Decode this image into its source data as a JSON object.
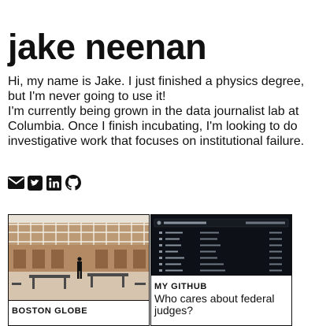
{
  "header": {
    "name": "jake neenan"
  },
  "bio": {
    "line1": "Hi, my name is Jake. I just finished a physics degree, but I'm never going to use it!",
    "line2": "I'm currently being grown in the data journalist lab at Columbia. Once I finish incubating, I'm looking to do investigative work that focuses on institutional failure."
  },
  "social": {
    "items": [
      {
        "icon": "email-icon"
      },
      {
        "icon": "twitter-icon"
      },
      {
        "icon": "linkedin-icon"
      },
      {
        "icon": "github-icon"
      }
    ]
  },
  "cards": [
    {
      "kicker": "BOSTON GLOBE",
      "image": "prison-cell-block-photo"
    },
    {
      "kicker": "MY GITHUB",
      "headline": "Who cares about federal judges?",
      "image": "github-repo-screenshot"
    }
  ]
}
